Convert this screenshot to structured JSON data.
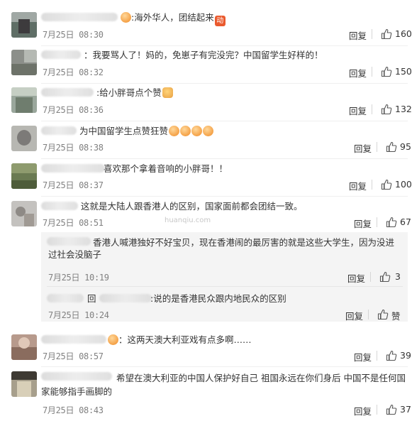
{
  "labels": {
    "reply": "回复"
  },
  "comments": [
    {
      "text": ":海外华人，团结起来",
      "time": "7月25日 08:30",
      "likes": "160"
    },
    {
      "text": "：我要骂人了！妈的，免崽子有完没完？中国留学生好样的！",
      "time": "7月25日 08:32",
      "likes": "150"
    },
    {
      "text": ":给小胖哥点个赞",
      "time": "7月25日 08:36",
      "likes": "132"
    },
    {
      "text": "为中国留学生点赞狂赞",
      "time": "7月25日 08:38",
      "likes": "95"
    },
    {
      "text": "喜欢那个拿着音响的小胖哥！！",
      "time": "7月25日 08:37",
      "likes": "100"
    },
    {
      "text": "这就是大陆人跟香港人的区别，国家面前都会团结一致。",
      "time": "7月25日 08:51",
      "likes": "67"
    },
    {
      "text": "：这两天澳大利亚戏有点多啊……",
      "time": "7月25日 08:57",
      "likes": "39"
    },
    {
      "text": "希望在澳大利亚的中国人保护好自己 祖国永远在你们身后 中国不是任何国家能够指手画脚的",
      "time": "7月25日 08:43",
      "likes": "37"
    }
  ],
  "subreplies": [
    {
      "text": "香港人喊港独好不好宝贝，现在香港闹的最厉害的就是这些大学生，因为没进过社会没脑子",
      "time": "7月25日 10:19",
      "likes": "3"
    },
    {
      "text_prefix": "回",
      "text": ":说的是香港民众跟内地民众的区别",
      "time": "7月25日 10:24",
      "likes": "赞"
    }
  ],
  "emoji_marks": {
    "red_badge": "动"
  },
  "watermark": "huanqiu.com",
  "colors": {
    "text": "#333333",
    "time": "#808080",
    "subbox_bg": "#f4f4f4",
    "divider": "#efefef"
  },
  "icons": {
    "like": "thumbs-up-icon"
  }
}
